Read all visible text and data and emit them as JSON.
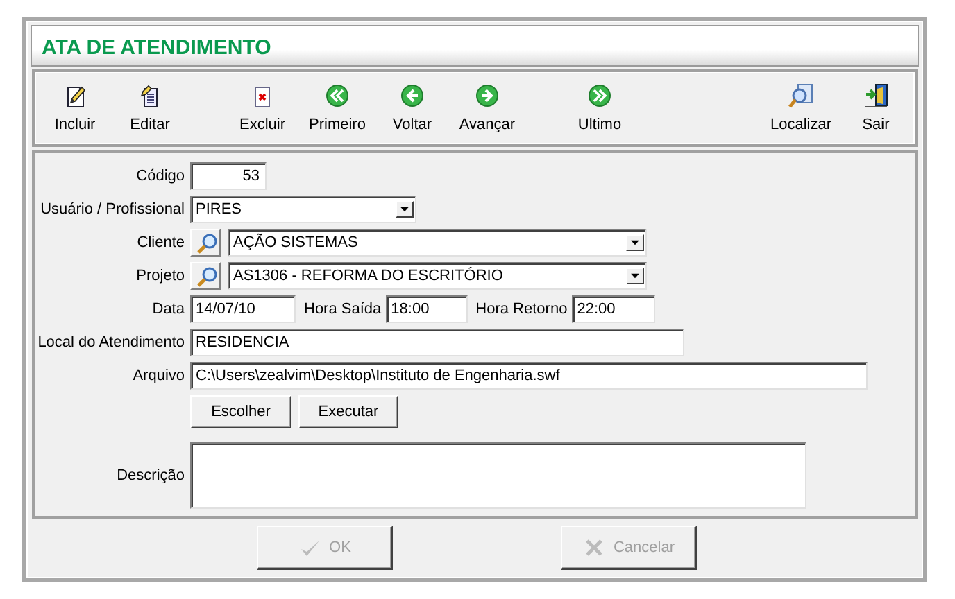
{
  "window": {
    "title": "ATA DE ATENDIMENTO"
  },
  "toolbar": [
    {
      "label": "Incluir",
      "kind": "new"
    },
    {
      "label": "Editar",
      "kind": "edit"
    },
    {
      "label": "Excluir",
      "kind": "delete"
    },
    {
      "label": "Primeiro",
      "kind": "first"
    },
    {
      "label": "Voltar",
      "kind": "prev"
    },
    {
      "label": "Avançar",
      "kind": "next"
    },
    {
      "label": "Ultimo",
      "kind": "last"
    },
    {
      "label": "Localizar",
      "kind": "find"
    },
    {
      "label": "Sair",
      "kind": "exit"
    }
  ],
  "form": {
    "codigo": {
      "label": "Código",
      "value": "53"
    },
    "usuario": {
      "label": "Usuário / Profissional",
      "value": "PIRES"
    },
    "cliente": {
      "label": "Cliente",
      "value": "AÇÃO SISTEMAS"
    },
    "projeto": {
      "label": "Projeto",
      "value": "AS1306 - REFORMA DO ESCRITÓRIO"
    },
    "data": {
      "label": "Data",
      "value": "14/07/10"
    },
    "hora_saida": {
      "label": "Hora Saída",
      "value": "18:00"
    },
    "hora_retorno": {
      "label": "Hora Retorno",
      "value": "22:00"
    },
    "local": {
      "label": "Local do Atendimento",
      "value": "RESIDENCIA"
    },
    "arquivo": {
      "label": "Arquivo",
      "value": "C:\\Users\\zealvim\\Desktop\\Instituto de Engenharia.swf"
    },
    "arquivo_buttons": [
      "Escolher",
      "Executar"
    ],
    "descricao": {
      "label": "Descrição"
    }
  },
  "buttons": [
    {
      "label": "OK",
      "kind": "ok",
      "disabled": true
    },
    {
      "label": "Cancelar",
      "kind": "cancel",
      "disabled": true
    }
  ]
}
